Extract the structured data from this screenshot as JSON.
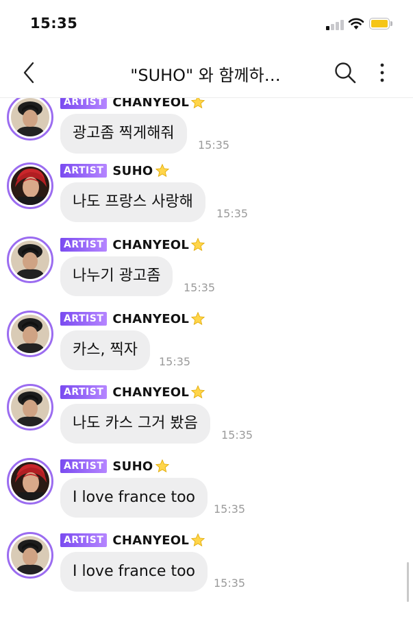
{
  "status_bar": {
    "time": "15:35",
    "battery_color": "#f5c518"
  },
  "nav": {
    "title": "\"SUHO\" 와 함께하…",
    "icons": [
      "chevron-left-icon",
      "search-icon",
      "more-vertical-icon"
    ]
  },
  "badge_colors": [
    "#7a4bf0",
    "#b585ff"
  ],
  "messages": [
    {
      "badge": "ARTIST",
      "sender": "CHANYEOL",
      "text": "광고좀 찍게해줘",
      "time": "15:35",
      "avatar": "chanyeol"
    },
    {
      "badge": "ARTIST",
      "sender": "SUHO",
      "text": "나도 프랑스 사랑해",
      "time": "15:35",
      "avatar": "suho"
    },
    {
      "badge": "ARTIST",
      "sender": "CHANYEOL",
      "text": "나누기 광고좀",
      "time": "15:35",
      "avatar": "chanyeol"
    },
    {
      "badge": "ARTIST",
      "sender": "CHANYEOL",
      "text": "카스, 찍자",
      "time": "15:35",
      "avatar": "chanyeol"
    },
    {
      "badge": "ARTIST",
      "sender": "CHANYEOL",
      "text": "나도 카스 그거 봤음",
      "time": "15:35",
      "avatar": "chanyeol"
    },
    {
      "badge": "ARTIST",
      "sender": "SUHO",
      "text": "I love france too",
      "time": "15:35",
      "avatar": "suho"
    },
    {
      "badge": "ARTIST",
      "sender": "CHANYEOL",
      "text": "I love france too",
      "time": "15:35",
      "avatar": "chanyeol"
    }
  ]
}
